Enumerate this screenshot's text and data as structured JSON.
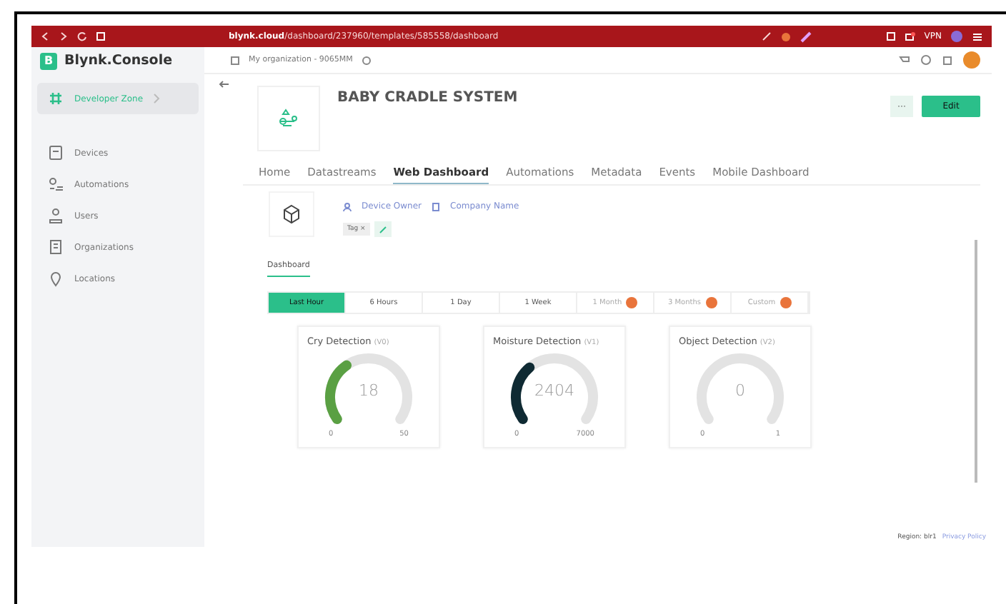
{
  "browser": {
    "url_host": "blynk.cloud",
    "url_path": "/dashboard/237960/templates/585558/dashboard",
    "vpn": "VPN"
  },
  "app": {
    "logo_letter": "B",
    "logo_text": "Blynk.Console",
    "organization": "My organization - 9065MM"
  },
  "sidebar": {
    "items": [
      {
        "label": "Developer Zone",
        "selected": true
      },
      {
        "label": "Devices",
        "selected": false
      },
      {
        "label": "Automations",
        "selected": false
      },
      {
        "label": "Users",
        "selected": false
      },
      {
        "label": "Organizations",
        "selected": false
      },
      {
        "label": "Locations",
        "selected": false
      }
    ]
  },
  "template": {
    "title": "BABY CRADLE SYSTEM",
    "more_button": "···",
    "edit_button": "Edit"
  },
  "tabs": [
    {
      "label": "Home",
      "selected": false
    },
    {
      "label": "Datastreams",
      "selected": false
    },
    {
      "label": "Web Dashboard",
      "selected": true
    },
    {
      "label": "Automations",
      "selected": false
    },
    {
      "label": "Metadata",
      "selected": false
    },
    {
      "label": "Events",
      "selected": false
    },
    {
      "label": "Mobile Dashboard",
      "selected": false
    }
  ],
  "device": {
    "owner": "Device Owner",
    "company": "Company Name",
    "tag": "Tag ×"
  },
  "dashboard_tab": "Dashboard",
  "ranges": [
    {
      "label": "Last Hour",
      "selected": true,
      "locked": false
    },
    {
      "label": "6 Hours",
      "selected": false,
      "locked": false
    },
    {
      "label": "1 Day",
      "selected": false,
      "locked": false
    },
    {
      "label": "1 Week",
      "selected": false,
      "locked": false
    },
    {
      "label": "1 Month",
      "selected": false,
      "locked": true
    },
    {
      "label": "3 Months",
      "selected": false,
      "locked": true
    },
    {
      "label": "Custom",
      "selected": false,
      "locked": true
    }
  ],
  "gauges": [
    {
      "title": "Cry Detection",
      "pin": "(V0)",
      "value": "18",
      "min": "0",
      "max": "50"
    },
    {
      "title": "Moisture Detection",
      "pin": "(V1)",
      "value": "2404",
      "min": "0",
      "max": "7000"
    },
    {
      "title": "Object Detection",
      "pin": "(V2)",
      "value": "0",
      "min": "0",
      "max": "1"
    }
  ],
  "footer": {
    "region": "Region: blr1",
    "privacy": "Privacy Policy"
  }
}
